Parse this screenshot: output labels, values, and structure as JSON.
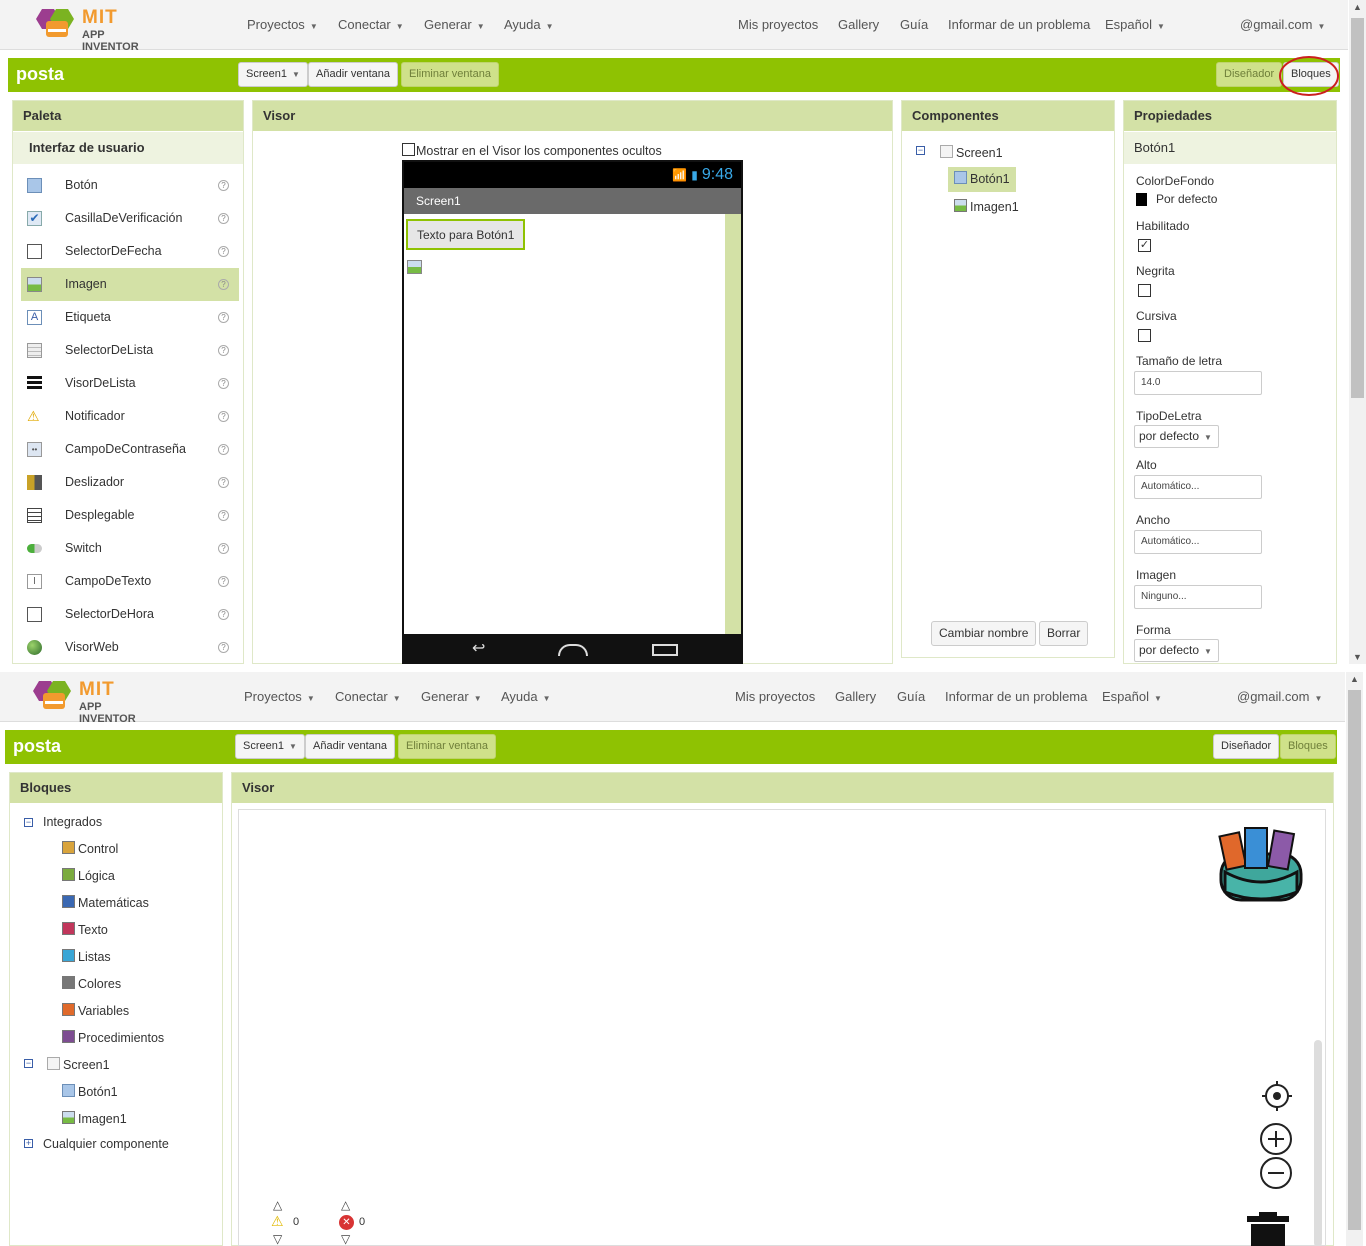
{
  "nav": {
    "logo_title": "MIT",
    "logo_subtitle": "APP INVENTOR",
    "menus": [
      "Proyectos",
      "Conectar",
      "Generar",
      "Ayuda"
    ],
    "links": [
      "Mis proyectos",
      "Gallery",
      "Guía",
      "Informar de un problema"
    ],
    "language": "Español",
    "account": "@gmail.com"
  },
  "toolbar": {
    "project_name": "posta",
    "screen_select": "Screen1",
    "add_screen": "Añadir ventana",
    "remove_screen": "Eliminar ventana",
    "designer": "Diseñador",
    "blocks": "Bloques"
  },
  "designer": {
    "palette": {
      "title": "Paleta",
      "category": "Interfaz de usuario",
      "items": [
        {
          "label": "Botón",
          "icon": "button-icon"
        },
        {
          "label": "CasillaDeVerificación",
          "icon": "checkbox-icon"
        },
        {
          "label": "SelectorDeFecha",
          "icon": "calendar-icon"
        },
        {
          "label": "Imagen",
          "icon": "image-icon",
          "selected": true
        },
        {
          "label": "Etiqueta",
          "icon": "label-icon"
        },
        {
          "label": "SelectorDeLista",
          "icon": "listpicker-icon"
        },
        {
          "label": "VisorDeLista",
          "icon": "listview-icon"
        },
        {
          "label": "Notificador",
          "icon": "warning-icon"
        },
        {
          "label": "CampoDeContraseña",
          "icon": "password-icon"
        },
        {
          "label": "Deslizador",
          "icon": "slider-icon"
        },
        {
          "label": "Desplegable",
          "icon": "spinner-icon"
        },
        {
          "label": "Switch",
          "icon": "switch-icon"
        },
        {
          "label": "CampoDeTexto",
          "icon": "textbox-icon"
        },
        {
          "label": "SelectorDeHora",
          "icon": "clock-icon"
        },
        {
          "label": "VisorWeb",
          "icon": "globe-icon"
        }
      ],
      "help": "?"
    },
    "viewer": {
      "title": "Visor",
      "show_hidden": "Mostrar en el Visor los componentes ocultos",
      "time": "9:48",
      "screen_title": "Screen1",
      "button_text": "Texto para Botón1"
    },
    "components": {
      "title": "Componentes",
      "tree": [
        "Screen1",
        "Botón1",
        "Imagen1"
      ],
      "rename": "Cambiar nombre",
      "delete": "Borrar"
    },
    "properties": {
      "title": "Propiedades",
      "component": "Botón1",
      "bg_label": "ColorDeFondo",
      "bg_value": "Por defecto",
      "enabled_label": "Habilitado",
      "bold_label": "Negrita",
      "italic_label": "Cursiva",
      "fontsize_label": "Tamaño de letra",
      "fontsize_value": "14.0",
      "typeface_label": "TipoDeLetra",
      "typeface_value": "por defecto",
      "height_label": "Alto",
      "height_value": "Automático...",
      "width_label": "Ancho",
      "width_value": "Automático...",
      "image_label": "Imagen",
      "image_value": "Ninguno...",
      "shape_label": "Forma",
      "shape_value": "por defecto"
    }
  },
  "blocks_view": {
    "panel_title": "Bloques",
    "viewer_title": "Visor",
    "builtin": "Integrados",
    "categories": [
      {
        "label": "Control",
        "color": "#d9a43c"
      },
      {
        "label": "Lógica",
        "color": "#7bab3f"
      },
      {
        "label": "Matemáticas",
        "color": "#3a68b2"
      },
      {
        "label": "Texto",
        "color": "#c1365b"
      },
      {
        "label": "Listas",
        "color": "#3aa6d6"
      },
      {
        "label": "Colores",
        "color": "#777777"
      },
      {
        "label": "Variables",
        "color": "#e06a2b"
      },
      {
        "label": "Procedimientos",
        "color": "#7d4d91"
      }
    ],
    "screen": "Screen1",
    "components": [
      "Botón1",
      "Imagen1"
    ],
    "any_component": "Cualquier componente",
    "warnings": "0",
    "errors": "0"
  },
  "colors": {
    "accent_green": "#8fc202",
    "header_green": "#d3e1a6",
    "highlight_red": "#cc1f1f"
  }
}
